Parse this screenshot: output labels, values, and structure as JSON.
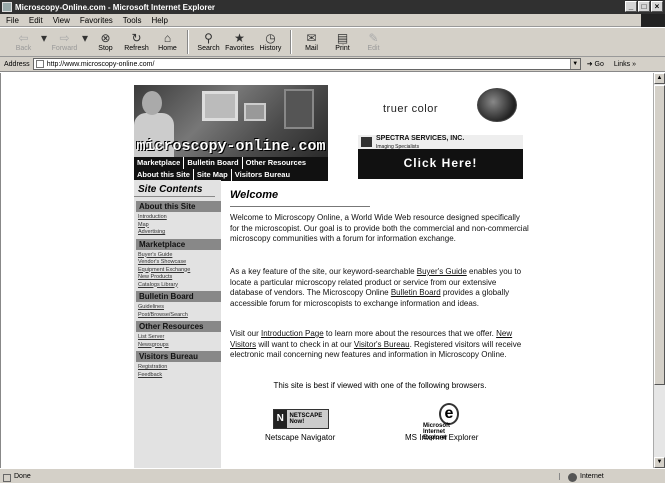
{
  "window": {
    "title": "Microscopy-Online.com - Microsoft Internet Explorer",
    "controls": [
      "_",
      "□",
      "×"
    ]
  },
  "menu": [
    "File",
    "Edit",
    "View",
    "Favorites",
    "Tools",
    "Help"
  ],
  "toolbar": {
    "back": "Back",
    "forward": "Forward",
    "stop": "Stop",
    "refresh": "Refresh",
    "home": "Home",
    "search": "Search",
    "favorites": "Favorites",
    "history": "History",
    "mail": "Mail",
    "print": "Print",
    "edit": "Edit"
  },
  "address": {
    "label": "Address",
    "url": "http://www.microscopy-online.com/",
    "go": "Go",
    "links": "Links"
  },
  "page": {
    "banner_logo": "microscopy-online.com",
    "nav_row1": [
      "Marketplace",
      "Bulletin Board",
      "Other Resources"
    ],
    "nav_row2": [
      "About this Site",
      "Site Map",
      "Visitors Bureau"
    ],
    "ad_text": "truer color",
    "spectra_name": "SPECTRA SERVICES, INC.",
    "spectra_sub": "Imaging Specialists",
    "spectra_cta": "Click Here!",
    "sidebar_title": "Site Contents",
    "sections": [
      {
        "head": "About this Site",
        "links": [
          "Introduction",
          "Map",
          "Advertising"
        ]
      },
      {
        "head": "Marketplace",
        "links": [
          "Buyer's Guide",
          "Vendor's Showcase",
          "Equipment Exchange",
          "New Products",
          "Catalogs Library"
        ]
      },
      {
        "head": "Bulletin Board",
        "links": [
          "Guidelines",
          "Post/Browse/Search"
        ]
      },
      {
        "head": "Other Resources",
        "links": [
          "List Server",
          "Newsgroups"
        ]
      },
      {
        "head": "Visitors Bureau",
        "links": [
          "Registration",
          "Feedback"
        ]
      }
    ],
    "welcome": "Welcome",
    "p1": "Welcome to Microscopy Online, a World Wide Web resource designed specifically for the microscopist. Our goal is to provide both the commercial and non-commercial microscopy communities with a forum for information exchange.",
    "p2_a": "As a key feature of the site, our keyword-searchable ",
    "p2_link1": "Buyer's Guide",
    "p2_b": " enables you to locate a particular microscopy related product or service from our extensive database of vendors. The Microscopy Online ",
    "p2_link2": "Bulletin Board",
    "p2_c": " provides a globally accessible forum for microscopists to exchange information and ideas.",
    "p3_a": "Visit our ",
    "p3_link1": "Introduction Page",
    "p3_b": " to learn more about the resources that we offer. ",
    "p3_link2": "New Visitors",
    "p3_c": " will want to check in at our ",
    "p3_link3": "Visitor's Bureau",
    "p3_d": ". Registered visitors will receive electronic mail concerning new features and information in Microscopy Online.",
    "browser_note": "This site is best if viewed with one of the following browsers.",
    "ns_badge": "NETSCAPE Now!",
    "ns_label": "Netscape Navigator",
    "ie_badge_1": "Microsoft",
    "ie_badge_2": "Internet Explorer",
    "ie_label": "MS Internet Explorer"
  },
  "status": {
    "text": "Done",
    "zone": "Internet"
  }
}
